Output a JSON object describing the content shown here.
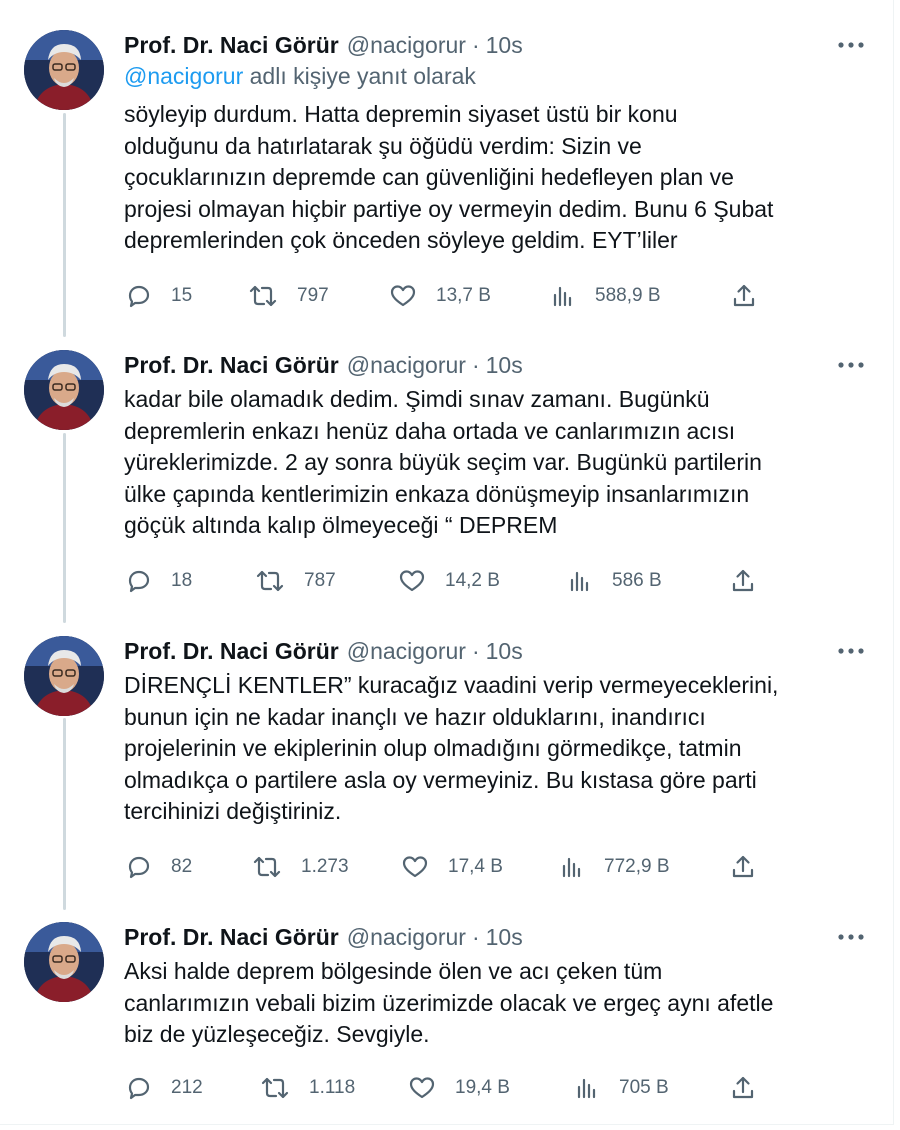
{
  "colors": {
    "text": "#0f1419",
    "secondary": "#536471",
    "link": "#1d9bf0",
    "thread_line": "#cfd9de"
  },
  "tweets": [
    {
      "name": "Prof. Dr. Naci Görür",
      "handle": "@nacigorur",
      "separator": "·",
      "time": "10s",
      "reply_mention": "@nacigorur",
      "reply_suffix": " adlı kişiye yanıt olarak",
      "text": "söyleyip durdum. Hatta depremin siyaset üstü bir konu\nolduğunu da hatırlatarak şu öğüdü verdim: Sizin ve\nçocuklarınızın depremde can güvenliğini hedefleyen  plan ve\nprojesi olmayan hiçbir partiye oy vermeyin dedim. Bunu 6 Şubat\ndepremlerinden çok önceden söyleye geldim. EYT’liler",
      "replies": "15",
      "retweets": "797",
      "likes": "13,7 B",
      "views": "588,9 B"
    },
    {
      "name": "Prof. Dr. Naci Görür",
      "handle": "@nacigorur",
      "separator": "·",
      "time": "10s",
      "text": "kadar bile olamadık dedim. Şimdi sınav zamanı. Bugünkü\ndepremlerin enkazı henüz daha ortada ve canlarımızın acısı\nyüreklerimizde. 2 ay sonra büyük seçim var. Bugünkü partilerin\nülke çapında kentlerimizin enkaza dönüşmeyip insanlarımızın\ngöçük altında kalıp ölmeyeceği “ DEPREM",
      "replies": "18",
      "retweets": "787",
      "likes": "14,2 B",
      "views": "586 B"
    },
    {
      "name": "Prof. Dr. Naci Görür",
      "handle": "@nacigorur",
      "separator": "·",
      "time": "10s",
      "text": "DİRENÇLİ KENTLER” kuracağız vaadini verip vermeyeceklerini,\nbunun için ne kadar inançlı ve hazır olduklarını, inandırıcı\nprojelerinin ve ekiplerinin olup olmadığını görmedikçe, tatmin\nolmadıkça o partilere asla oy vermeyiniz. Bu kıstasa göre parti\ntercihinizi değiştiriniz.",
      "replies": "82",
      "retweets": "1.273",
      "likes": "17,4 B",
      "views": "772,9 B"
    },
    {
      "name": "Prof. Dr. Naci Görür",
      "handle": "@nacigorur",
      "separator": "·",
      "time": "10s",
      "text": "Aksi halde deprem bölgesinde ölen ve acı çeken tüm\ncanlarımızın vebali bizim üzerimizde olacak ve ergeç aynı afetle\nbiz de yüzleşeceğiz. Sevgiyle.",
      "replies": "212",
      "retweets": "1.118",
      "likes": "19,4 B",
      "views": "705 B"
    }
  ]
}
